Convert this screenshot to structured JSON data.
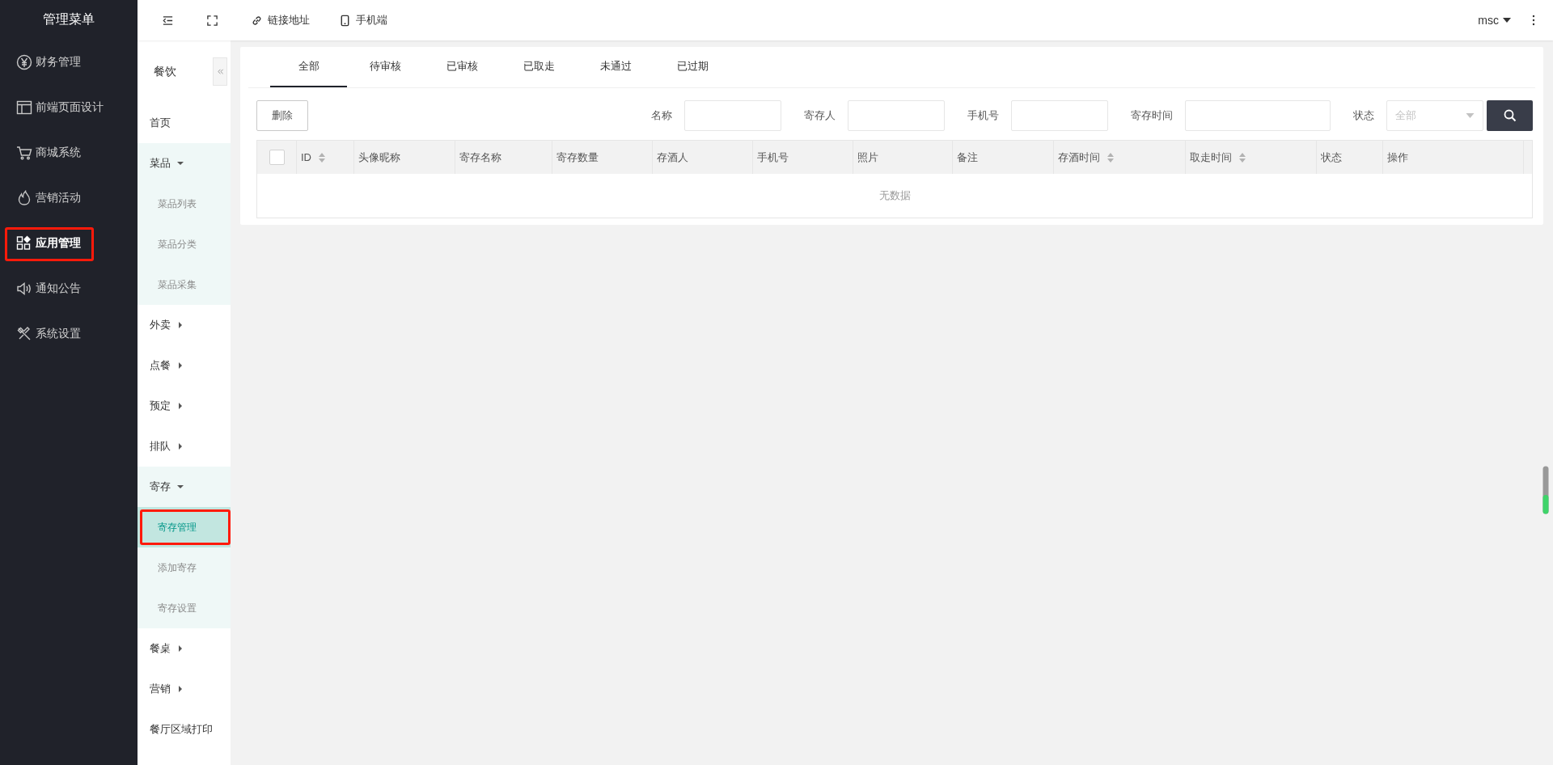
{
  "main_menu": {
    "title": "管理菜单",
    "items": [
      {
        "label": "财务管理",
        "highlighted": false
      },
      {
        "label": "前端页面设计",
        "highlighted": false
      },
      {
        "label": "商城系统",
        "highlighted": false
      },
      {
        "label": "营销活动",
        "highlighted": false
      },
      {
        "label": "应用管理",
        "highlighted": true
      },
      {
        "label": "通知公告",
        "highlighted": false
      },
      {
        "label": "系统设置",
        "highlighted": false
      }
    ]
  },
  "top_bar": {
    "links": [
      "链接地址",
      "手机端"
    ],
    "user": "msc"
  },
  "sub_menu": {
    "title": "餐饮",
    "items": [
      {
        "label": "首页"
      },
      {
        "label": "菜品",
        "expanded": true,
        "children": [
          {
            "label": "菜品列表",
            "selected": false,
            "highlighted": false
          },
          {
            "label": "菜品分类",
            "selected": false,
            "highlighted": false
          },
          {
            "label": "菜品采集",
            "selected": false,
            "highlighted": false
          }
        ]
      },
      {
        "label": "外卖",
        "expanded": false
      },
      {
        "label": "点餐",
        "expanded": false
      },
      {
        "label": "预定",
        "expanded": false
      },
      {
        "label": "排队",
        "expanded": false
      },
      {
        "label": "寄存",
        "expanded": true,
        "children": [
          {
            "label": "寄存管理",
            "selected": true,
            "highlighted": true
          },
          {
            "label": "添加寄存",
            "selected": false,
            "highlighted": false
          },
          {
            "label": "寄存设置",
            "selected": false,
            "highlighted": false
          }
        ]
      },
      {
        "label": "餐桌",
        "expanded": false
      },
      {
        "label": "营销",
        "expanded": false
      },
      {
        "label": "餐厅区域打印"
      }
    ]
  },
  "tabs": [
    {
      "label": "全部",
      "selected": true
    },
    {
      "label": "待审核",
      "selected": false
    },
    {
      "label": "已审核",
      "selected": false
    },
    {
      "label": "已取走",
      "selected": false
    },
    {
      "label": "未通过",
      "selected": false
    },
    {
      "label": "已过期",
      "selected": false
    }
  ],
  "toolbar": {
    "delete_button": "删除",
    "filters": [
      {
        "label": "名称",
        "kind": "text"
      },
      {
        "label": "寄存人",
        "kind": "text"
      },
      {
        "label": "手机号",
        "kind": "text"
      },
      {
        "label": "寄存时间",
        "kind": "date"
      },
      {
        "label": "状态",
        "kind": "select",
        "placeholder": "全部"
      }
    ]
  },
  "table": {
    "select_all_checked": false,
    "columns": [
      {
        "label": "ID",
        "sortable": true
      },
      {
        "label": "头像昵称",
        "sortable": false
      },
      {
        "label": "寄存名称",
        "sortable": false
      },
      {
        "label": "寄存数量",
        "sortable": false
      },
      {
        "label": "存酒人",
        "sortable": false
      },
      {
        "label": "手机号",
        "sortable": false
      },
      {
        "label": "照片",
        "sortable": false
      },
      {
        "label": "备注",
        "sortable": false
      },
      {
        "label": "存酒时间",
        "sortable": true
      },
      {
        "label": "取走时间",
        "sortable": true
      },
      {
        "label": "状态",
        "sortable": false
      },
      {
        "label": "操作",
        "sortable": false
      }
    ],
    "empty_text": "无数据"
  }
}
